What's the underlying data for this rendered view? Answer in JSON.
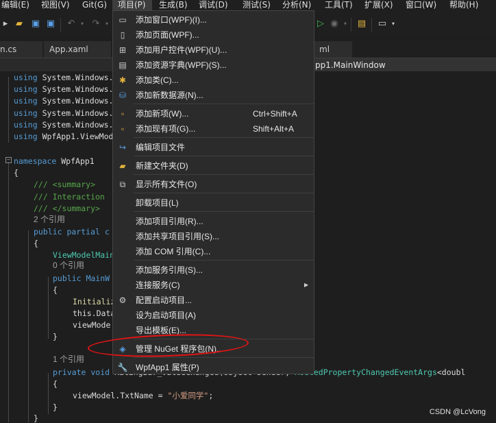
{
  "menubar": {
    "items": [
      {
        "label": "编辑(E)"
      },
      {
        "label": "视图(V)"
      },
      {
        "label": "Git(G)"
      },
      {
        "label": "项目(P)"
      },
      {
        "label": "生成(B)"
      },
      {
        "label": "调试(D)"
      },
      {
        "label": "测试(S)"
      },
      {
        "label": "分析(N)"
      },
      {
        "label": "工具(T)"
      },
      {
        "label": "扩展(X)"
      },
      {
        "label": "窗口(W)"
      },
      {
        "label": "帮助(H)"
      }
    ]
  },
  "tabs": [
    {
      "label": "n.cs"
    },
    {
      "label": "App.xaml"
    },
    {
      "label": "ml"
    }
  ],
  "navbar": {
    "text": "pp1.MainWindow"
  },
  "code": {
    "usings": [
      "System.Windows.",
      "System.Windows.",
      "System.Windows.",
      "System.Windows.",
      "System.Windows.",
      "WpfApp1.ViewMod"
    ],
    "using_kw": "using",
    "namespace_kw": "namespace",
    "namespace_name": "WpfApp1",
    "summary_open": "/// <summary>",
    "summary_text": "/// Interaction",
    "summary_close": "/// </summary>",
    "ref_2": "2 个引用",
    "class_decl": "public partial c",
    "field_decl": "ViewModelMain",
    "ref_0": "0 个引用",
    "ctor_decl": "public MainW",
    "init_call": "Initializ",
    "this_line": "this.Data",
    "vm_line": "viewMode",
    "ref_1": "1 个引用",
    "method_kw": "private void",
    "method_mid": "RatingBar_ValueChanged(object sender,",
    "method_type": "RoutedPropertyChangedEventArgs",
    "method_tail": "<doubl",
    "assign_left": "viewModel.TxtName = ",
    "assign_str": "\"小爱同学\"",
    "assign_end": ";"
  },
  "dropdown": {
    "items": [
      {
        "icon": "add-window-icon",
        "label": "添加窗口(WPF)(I)...",
        "shortcut": ""
      },
      {
        "icon": "add-page-icon",
        "label": "添加页面(WPF)...",
        "shortcut": ""
      },
      {
        "icon": "add-user-control-icon",
        "label": "添加用户控件(WPF)(U)...",
        "shortcut": ""
      },
      {
        "icon": "add-resource-dictionary-icon",
        "label": "添加资源字典(WPF)(S)...",
        "shortcut": ""
      },
      {
        "icon": "add-class-icon",
        "label": "添加类(C)...",
        "shortcut": ""
      },
      {
        "icon": "add-data-source-icon",
        "label": "添加新数据源(N)...",
        "shortcut": ""
      },
      {
        "icon": "add-new-item-icon",
        "label": "添加新项(W)...",
        "shortcut": "Ctrl+Shift+A"
      },
      {
        "icon": "add-existing-item-icon",
        "label": "添加现有项(G)...",
        "shortcut": "Shift+Alt+A"
      },
      {
        "icon": "edit-project-file-icon",
        "label": "编辑项目文件",
        "shortcut": ""
      },
      {
        "icon": "new-folder-icon",
        "label": "新建文件夹(D)",
        "shortcut": ""
      },
      {
        "icon": "show-all-files-icon",
        "label": "显示所有文件(O)",
        "shortcut": ""
      },
      {
        "icon": "",
        "label": "卸载项目(L)",
        "shortcut": ""
      },
      {
        "icon": "",
        "label": "添加项目引用(R)...",
        "shortcut": ""
      },
      {
        "icon": "",
        "label": "添加共享项目引用(S)...",
        "shortcut": ""
      },
      {
        "icon": "",
        "label": "添加 COM 引用(C)...",
        "shortcut": ""
      },
      {
        "icon": "",
        "label": "添加服务引用(S)...",
        "shortcut": ""
      },
      {
        "icon": "",
        "label": "连接服务(C)",
        "shortcut": ""
      },
      {
        "icon": "gear-icon",
        "label": "配置启动项目...",
        "shortcut": ""
      },
      {
        "icon": "",
        "label": "设为启动项目(A)",
        "shortcut": ""
      },
      {
        "icon": "",
        "label": "导出模板(E)...",
        "shortcut": ""
      },
      {
        "icon": "nuget-icon",
        "label": "管理 NuGet 程序包(N)...",
        "shortcut": ""
      },
      {
        "icon": "wrench-icon",
        "label": "WpfApp1 属性(P)",
        "shortcut": ""
      }
    ]
  },
  "watermark": "CSDN @LcVong",
  "colors": {
    "highlight_circle": "#e51414",
    "keyword": "#569cd6",
    "comment": "#57a64a",
    "type": "#4ec9b0",
    "string": "#d69d85"
  }
}
